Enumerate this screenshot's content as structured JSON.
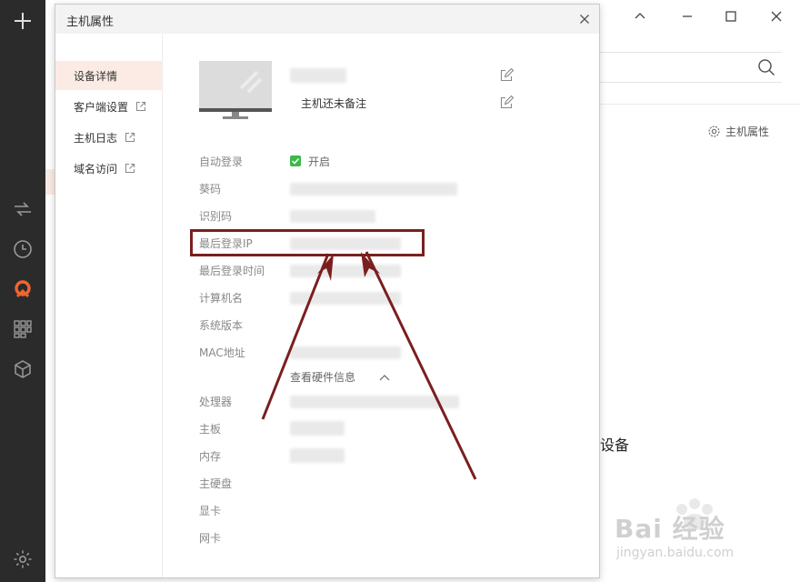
{
  "rail": {
    "icons": [
      "plus-icon",
      "transfer-icon",
      "clock-icon",
      "brand-icon",
      "apps-icon",
      "cube-icon",
      "settings-icon"
    ]
  },
  "background": {
    "host_property_label": "主机属性",
    "device_text": "设备"
  },
  "dialog": {
    "title": "主机属性",
    "nav": [
      {
        "label": "设备详情",
        "external": false,
        "active": true
      },
      {
        "label": "客户端设置",
        "external": true,
        "active": false
      },
      {
        "label": "主机日志",
        "external": true,
        "active": false
      },
      {
        "label": "域名访问",
        "external": true,
        "active": false
      }
    ],
    "host": {
      "remark": "主机还未备注"
    },
    "fields": [
      {
        "label": "自动登录"
      },
      {
        "label": "葵码"
      },
      {
        "label": "识别码"
      },
      {
        "label": "最后登录IP"
      },
      {
        "label": "最后登录时间"
      },
      {
        "label": "计算机名"
      },
      {
        "label": "系统版本"
      },
      {
        "label": "MAC地址"
      }
    ],
    "autologin_value": "开启",
    "hardware_toggle": "查看硬件信息",
    "hardware": [
      {
        "label": "处理器"
      },
      {
        "label": "主板"
      },
      {
        "label": "内存"
      },
      {
        "label": "主硬盘"
      },
      {
        "label": "显卡"
      },
      {
        "label": "网卡"
      }
    ]
  },
  "watermark": {
    "text": "Bai 经验",
    "sub": "jingyan.baidu.com"
  },
  "colors": {
    "rail": "#2b2b2b",
    "accent": "#f0652f",
    "highlight": "#7a1f1f",
    "active_nav": "#fcebe5",
    "check": "#3cb84a"
  }
}
